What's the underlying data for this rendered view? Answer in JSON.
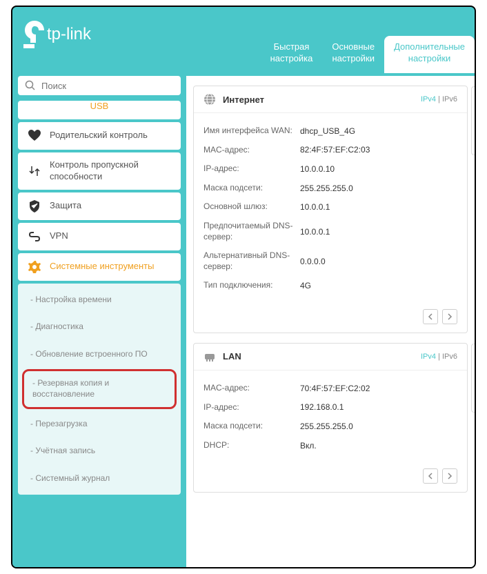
{
  "brand": "tp-link",
  "tabs": [
    {
      "label": "Быстрая\nнастройка"
    },
    {
      "label": "Основные\nнастройки"
    },
    {
      "label": "Дополнительные\nнастройки"
    }
  ],
  "search": {
    "placeholder": "Поиск"
  },
  "sidebar": {
    "items": [
      {
        "label": "USB"
      },
      {
        "label": "Родительский контроль"
      },
      {
        "label": "Контроль пропускной способности"
      },
      {
        "label": "Защита"
      },
      {
        "label": "VPN"
      },
      {
        "label": "Системные инструменты"
      }
    ],
    "subitems": [
      {
        "label": "- Настройка времени"
      },
      {
        "label": "- Диагностика"
      },
      {
        "label": "- Обновление встроенного ПО"
      },
      {
        "label": "- Резервная копия и восстановление"
      },
      {
        "label": "- Перезагрузка"
      },
      {
        "label": "- Учётная запись"
      },
      {
        "label": "- Системный журнал"
      }
    ]
  },
  "cards": {
    "internet": {
      "title": "Интернет",
      "ipv4": "IPv4",
      "ipv6": "IPv6",
      "rows": [
        {
          "label": "Имя интерфейса WAN:",
          "value": "dhcp_USB_4G"
        },
        {
          "label": "MAC-адрес:",
          "value": "82:4F:57:EF:C2:03"
        },
        {
          "label": "IP-адрес:",
          "value": "10.0.0.10"
        },
        {
          "label": "Маска подсети:",
          "value": "255.255.255.0"
        },
        {
          "label": "Основной шлюз:",
          "value": "10.0.0.1"
        },
        {
          "label": "Предпочитаемый DNS-сервер:",
          "value": "10.0.0.1"
        },
        {
          "label": "Альтернативный DNS-сервер:",
          "value": "0.0.0.0"
        },
        {
          "label": "Тип подключения:",
          "value": "4G"
        }
      ]
    },
    "lan": {
      "title": "LAN",
      "ipv4": "IPv4",
      "ipv6": "IPv6",
      "rows": [
        {
          "label": "MAC-адрес:",
          "value": "70:4F:57:EF:C2:02"
        },
        {
          "label": "IP-адрес:",
          "value": "192.168.0.1"
        },
        {
          "label": "Маска подсети:",
          "value": "255.255.255.0"
        },
        {
          "label": "DHCP:",
          "value": "Вкл."
        }
      ]
    }
  }
}
